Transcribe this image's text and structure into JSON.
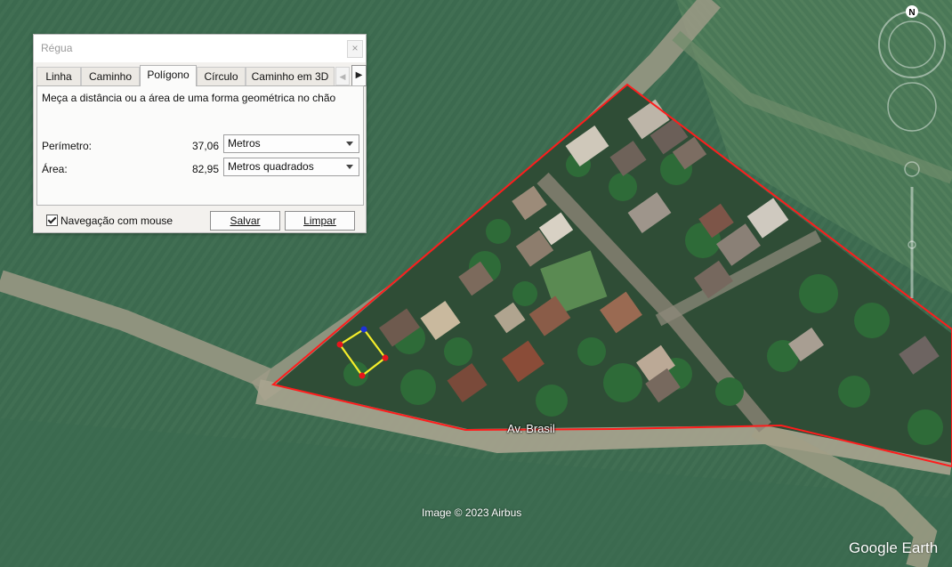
{
  "dialog": {
    "title": "Régua",
    "close_glyph": "×",
    "tabs": [
      "Linha",
      "Caminho",
      "Polígono",
      "Círculo",
      "Caminho em 3D"
    ],
    "active_tab": "Polígono",
    "description": "Meça a distância ou a área de uma forma geométrica no chão",
    "perimeter": {
      "label": "Perímetro:",
      "value": "37,06",
      "unit": "Metros"
    },
    "area": {
      "label": "Área:",
      "value": "82,95",
      "unit": "Metros quadrados"
    },
    "mouse_nav_label": "Navegação com mouse",
    "mouse_nav_checked": true,
    "save_label": "Salvar",
    "clear_label": "Limpar"
  },
  "map": {
    "road_label": "Av. Brasil",
    "credit": "Image © 2023 Airbus",
    "brand": "Google Earth",
    "compass_label": "N",
    "colors": {
      "outline": "#ff1c1c",
      "measure_polygon": "#f5ee2a",
      "vertex": "#e8141b",
      "active_vertex": "#1e32d8"
    }
  }
}
